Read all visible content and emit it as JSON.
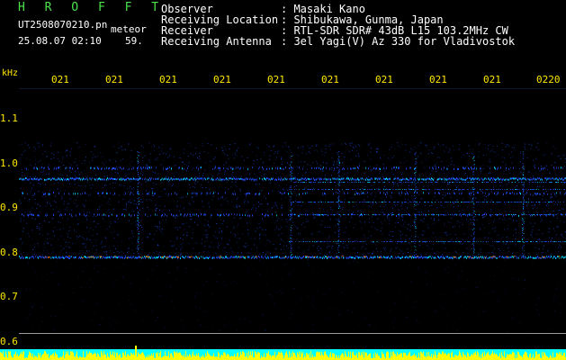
{
  "header": {
    "brand": "H R O F F T",
    "filename": "UT2508070210.pn",
    "subtitle": "meteor",
    "datetime": "25.08.07 02:10",
    "count": "59.",
    "fields": [
      {
        "label": "Observer",
        "value": ": Masaki Kano"
      },
      {
        "label": "Receiving Location",
        "value": ": Shibukawa, Gunma, Japan"
      },
      {
        "label": "Receiver",
        "value": ": RTL-SDR SDR# 43dB L15 103.2MHz CW"
      },
      {
        "label": "Receiving Antenna",
        "value": ": 3el Yagi(V) Az 330 for Vladivostok"
      }
    ]
  },
  "axis": {
    "unit": "kHz",
    "y_ticks": [
      "1.1",
      "1.0",
      "0.9",
      "0.8",
      "0.7",
      "0.6"
    ],
    "x_ticks": [
      "021",
      "021",
      "021",
      "021",
      "021",
      "021",
      "021",
      "021",
      "021",
      "0220"
    ]
  },
  "colors": {
    "text_green": "#4ce24c",
    "text_white": "#ffffff",
    "text_yellow": "#ffe600",
    "signal_blue": "#2050ff",
    "signal_cyan": "#00d8ff",
    "signal_orange": "#ff8a00",
    "footer_cyan": "#00ffff",
    "footer_yellow": "#ffff00"
  }
}
